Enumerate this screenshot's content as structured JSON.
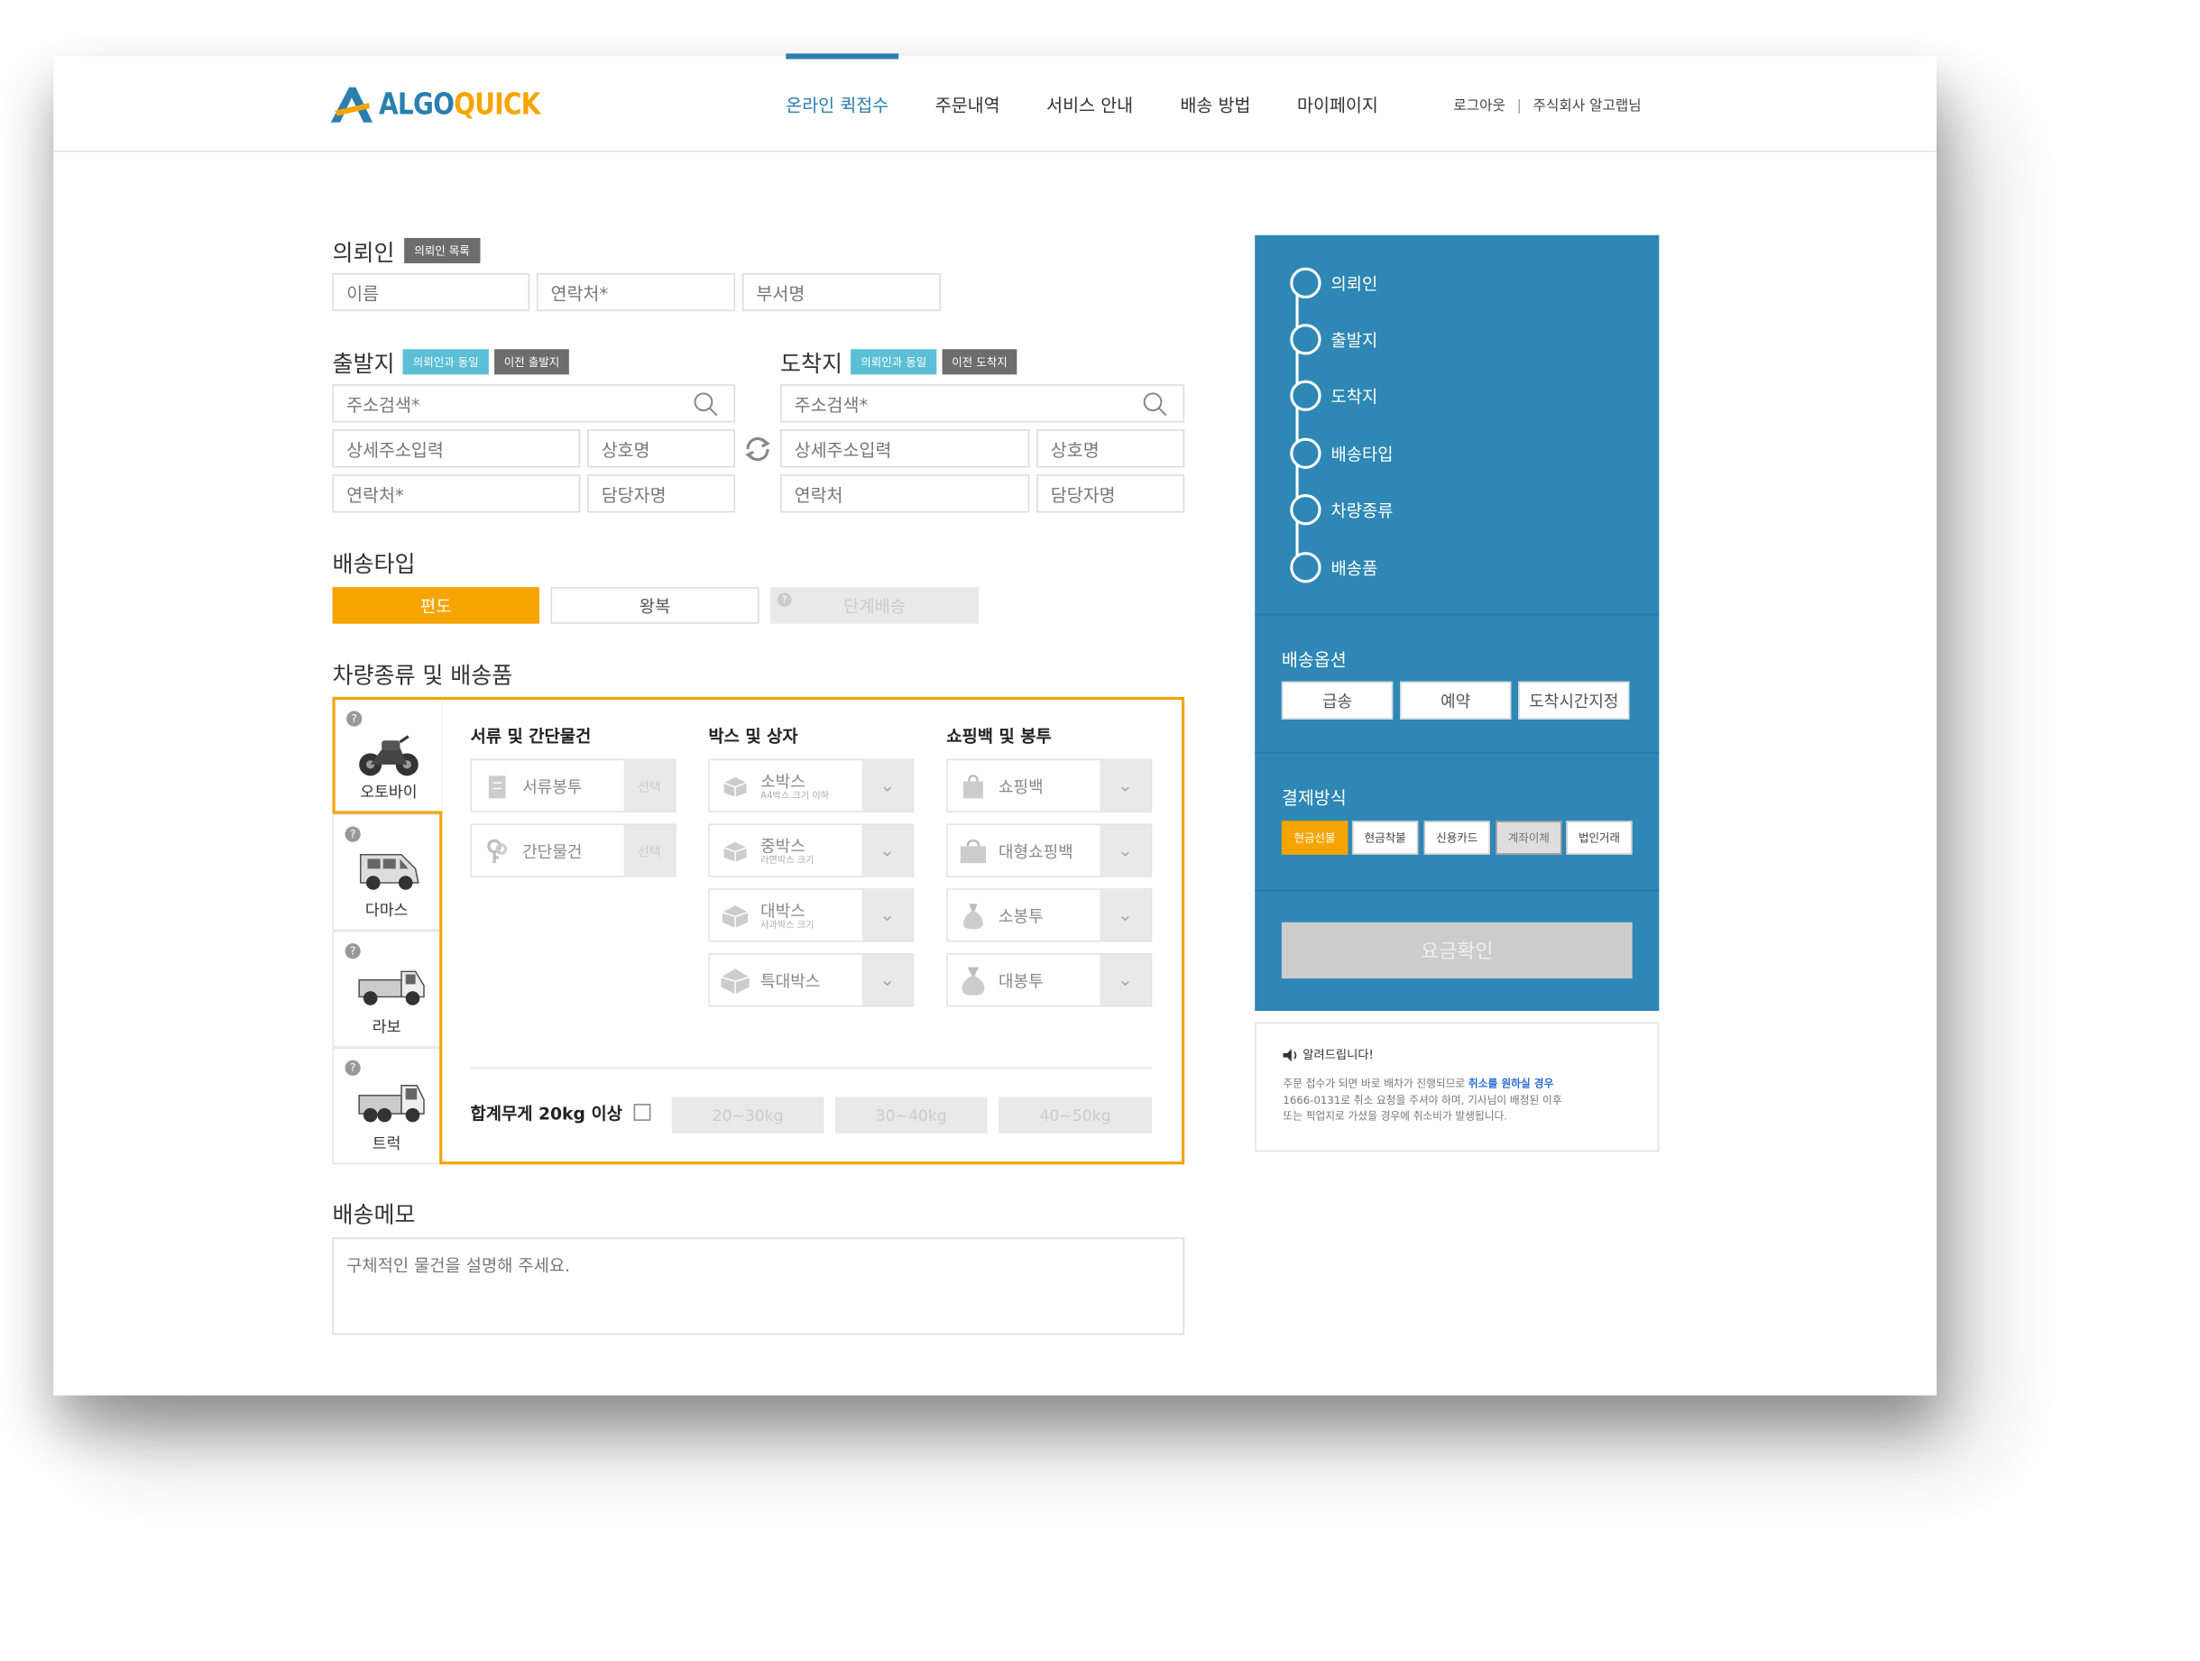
{
  "logo": {
    "part1": "ALGO",
    "part2": "QUICK"
  },
  "nav": [
    "온라인 퀵접수",
    "주문내역",
    "서비스 안내",
    "배송 방법",
    "마이페이지"
  ],
  "auth": {
    "logout": "로그아웃",
    "sep": "|",
    "user": "주식회사 알고랩님"
  },
  "client": {
    "title": "의뢰인",
    "list_badge": "의뢰인 목록",
    "name_ph": "이름",
    "phone_ph": "연락처*",
    "dept_ph": "부서명"
  },
  "origin": {
    "title": "출발지",
    "same_badge": "의뢰인과 동일",
    "prev_badge": "이전 출발지",
    "search_ph": "주소검색*",
    "detail_ph": "상세주소입력",
    "biz_ph": "상호명",
    "phone_ph": "연락처*",
    "contact_ph": "담당자명"
  },
  "dest": {
    "title": "도착지",
    "same_badge": "의뢰인과 동일",
    "prev_badge": "이전 도착지",
    "search_ph": "주소검색*",
    "detail_ph": "상세주소입력",
    "biz_ph": "상호명",
    "phone_ph": "연락처",
    "contact_ph": "담당자명"
  },
  "delivery_type": {
    "title": "배송타입",
    "options": [
      "편도",
      "왕복",
      "단계배송"
    ],
    "selected": "편도"
  },
  "vehicle_section": {
    "title": "차량종류 및 배송품"
  },
  "vehicles": [
    {
      "label": "오토바이",
      "selected": true
    },
    {
      "label": "다마스",
      "selected": false
    },
    {
      "label": "라보",
      "selected": false
    },
    {
      "label": "트럭",
      "selected": false
    }
  ],
  "items": {
    "doc_title": "서류 및 간단물건",
    "box_title": "박스 및 상자",
    "bag_title": "쇼핑백 및 봉투",
    "doc": [
      {
        "name": "서류봉투",
        "btn": "선택"
      },
      {
        "name": "간단물건",
        "btn": "선택"
      }
    ],
    "box": [
      {
        "name": "소박스",
        "sub": "A4박스 크기 이하"
      },
      {
        "name": "중박스",
        "sub": "라면박스 크기"
      },
      {
        "name": "대박스",
        "sub": "사과박스 크기"
      },
      {
        "name": "특대박스"
      }
    ],
    "bag": [
      {
        "name": "쇼핑백"
      },
      {
        "name": "대형쇼핑백"
      },
      {
        "name": "소봉투"
      },
      {
        "name": "대봉투"
      }
    ]
  },
  "weight": {
    "label": "합계무게 20kg 이상",
    "checked": false,
    "options": [
      "20~30kg",
      "30~40kg",
      "40~50kg"
    ]
  },
  "memo": {
    "title": "배송메모",
    "placeholder": "구체적인 물건을 설명해 주세요."
  },
  "steps": [
    "의뢰인",
    "출발지",
    "도착지",
    "배송타입",
    "차량종류",
    "배송품"
  ],
  "delivery_options": {
    "title": "배송옵션",
    "options": [
      "급송",
      "예약",
      "도착시간지정"
    ]
  },
  "payment": {
    "title": "결제방식",
    "options": [
      "현금선불",
      "현금착불",
      "신용카드",
      "계좌이체",
      "법인거래"
    ],
    "selected": "현금선불"
  },
  "fee_button": "요금확인",
  "notice": {
    "title": "알려드립니다!",
    "line1_a": "주문 접수가 되면 바로 배차가 진행되므로 ",
    "line1_link": "취소를 원하실 경우",
    "line2": "1666-0131로 취소 요청을 주셔야 하며, 기사님이 배정된 이후",
    "line3": "또는 픽업지로 가셨을 경우에 취소비가 발생됩니다."
  },
  "colors": {
    "brand_blue": "#2b7fae",
    "brand_orange": "#f7a400",
    "sidebar": "#2e87b5"
  }
}
